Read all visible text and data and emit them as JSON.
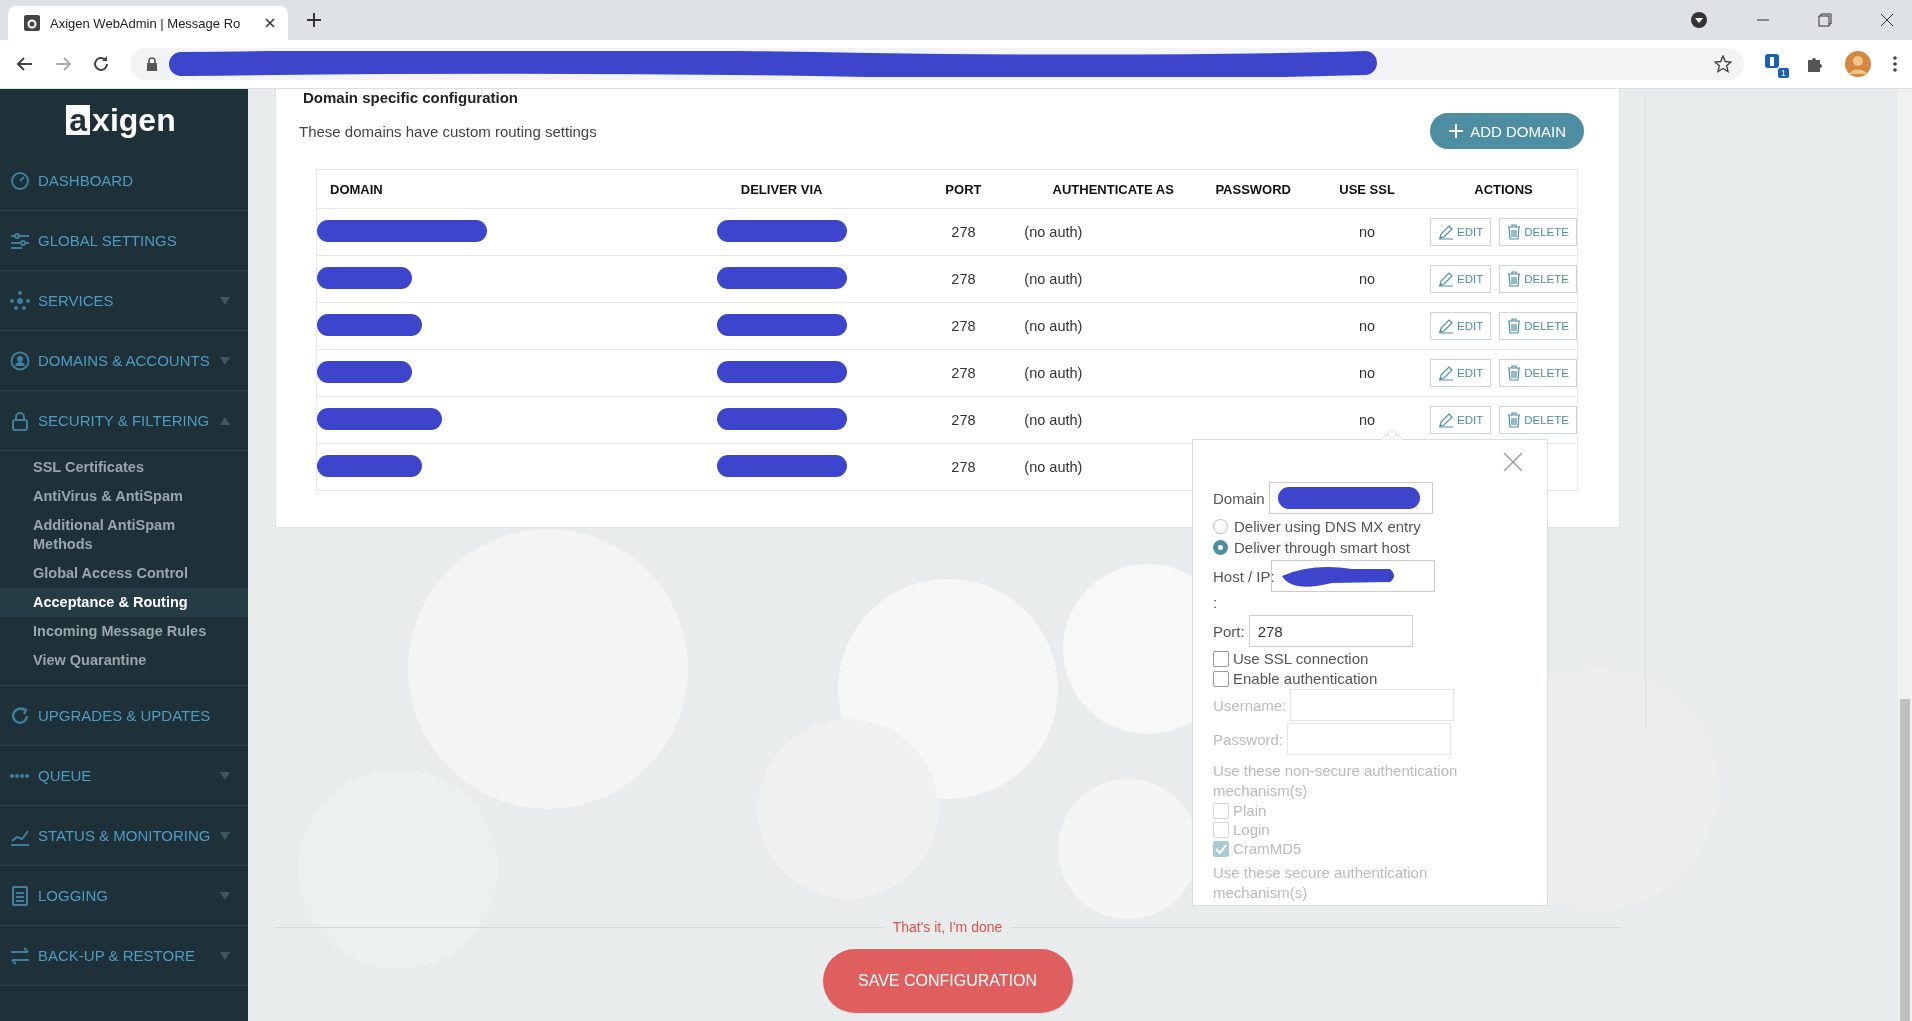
{
  "browser": {
    "tab_title": "Axigen WebAdmin | Message Ro",
    "extension_badge": "1"
  },
  "sidebar": {
    "logo_mark": "a",
    "logo_text": "xigen",
    "items": [
      {
        "label": "DASHBOARD"
      },
      {
        "label": "GLOBAL SETTINGS"
      },
      {
        "label": "SERVICES",
        "expanded": false
      },
      {
        "label": "DOMAINS & ACCOUNTS",
        "expanded": false
      },
      {
        "label": "SECURITY & FILTERING",
        "expanded": true,
        "children": [
          {
            "label": "SSL Certificates",
            "selected": false
          },
          {
            "label": "AntiVirus & AntiSpam",
            "selected": false
          },
          {
            "label": "Additional AntiSpam Methods",
            "selected": false
          },
          {
            "label": "Global Access Control",
            "selected": false
          },
          {
            "label": "Acceptance & Routing",
            "selected": true
          },
          {
            "label": "Incoming Message Rules",
            "selected": false
          },
          {
            "label": "View Quarantine",
            "selected": false
          }
        ]
      },
      {
        "label": "UPGRADES & UPDATES"
      },
      {
        "label": "QUEUE",
        "expanded": false
      },
      {
        "label": "STATUS & MONITORING",
        "expanded": false
      },
      {
        "label": "LOGGING",
        "expanded": false
      },
      {
        "label": "BACK-UP & RESTORE",
        "expanded": false
      }
    ]
  },
  "section": {
    "title": "Domain specific configuration",
    "description": "These domains have custom routing settings",
    "add_button": "ADD DOMAIN",
    "table": {
      "columns": [
        "DOMAIN",
        "DELIVER VIA",
        "PORT",
        "AUTHENTICATE AS",
        "PASSWORD",
        "USE SSL",
        "ACTIONS"
      ],
      "rows": [
        {
          "port": "278",
          "authenticate_as": "(no auth)",
          "use_ssl": "no",
          "actions": [
            "EDIT",
            "DELETE"
          ]
        },
        {
          "port": "278",
          "authenticate_as": "(no auth)",
          "use_ssl": "no",
          "actions": [
            "EDIT",
            "DELETE"
          ]
        },
        {
          "port": "278",
          "authenticate_as": "(no auth)",
          "use_ssl": "no",
          "actions": [
            "EDIT",
            "DELETE"
          ]
        },
        {
          "port": "278",
          "authenticate_as": "(no auth)",
          "use_ssl": "no",
          "actions": [
            "EDIT",
            "DELETE"
          ]
        },
        {
          "port": "278",
          "authenticate_as": "(no auth)",
          "use_ssl": "no",
          "actions": [
            "EDIT",
            "DELETE"
          ]
        },
        {
          "port": "278",
          "authenticate_as": "(no auth)"
        }
      ]
    }
  },
  "popup": {
    "domain_label": "Domain",
    "delivery_options": [
      {
        "label": "Deliver using DNS MX entry",
        "selected": false
      },
      {
        "label": "Deliver through smart host",
        "selected": true
      }
    ],
    "host_label": "Host / IP:",
    "separator": ":",
    "port_label": "Port:",
    "port_value": "278",
    "options": [
      {
        "label": "Use SSL connection",
        "checked": false,
        "disabled": false
      },
      {
        "label": "Enable authentication",
        "checked": false,
        "disabled": false
      }
    ],
    "username_label": "Username:",
    "password_label": "Password:",
    "credentials_disabled": true,
    "non_secure_heading": "Use these non-secure authentication mechanism(s)",
    "mechanisms": [
      {
        "label": "Plain",
        "checked": false,
        "disabled": true
      },
      {
        "label": "Login",
        "checked": false,
        "disabled": true
      },
      {
        "label": "CramMD5",
        "checked": true,
        "disabled": true
      }
    ],
    "secure_heading": "Use these secure authentication mechanism(s)"
  },
  "footer": {
    "note": "That's it, I'm done",
    "save_button": "SAVE CONFIGURATION"
  }
}
